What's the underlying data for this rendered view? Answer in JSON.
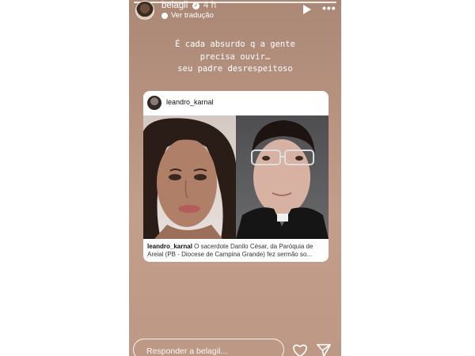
{
  "header": {
    "username": "belagil",
    "verified_mark": "✓",
    "time": "4 h",
    "translate_label": "Ver tradução",
    "more_label": "•••"
  },
  "story": {
    "caption_lines": [
      "É cada absurdo q a gente",
      "precisa ouvir…",
      "seu padre desrespeitoso"
    ]
  },
  "shared_post": {
    "username": "leandro_karnal",
    "caption_user": "leandro_karnal",
    "caption_text": " O sacerdote Danilo César, da Paróquia de Areial (PB - Diocese de Campina Grande) fez sermão so..."
  },
  "reply": {
    "placeholder": "Responder a belagil..."
  },
  "colors": {
    "story_bg": "#b6927f",
    "text": "#ffffff"
  },
  "icons": [
    "play-icon",
    "more-icon",
    "verified-icon",
    "translate-icon",
    "heart-icon",
    "send-icon"
  ]
}
